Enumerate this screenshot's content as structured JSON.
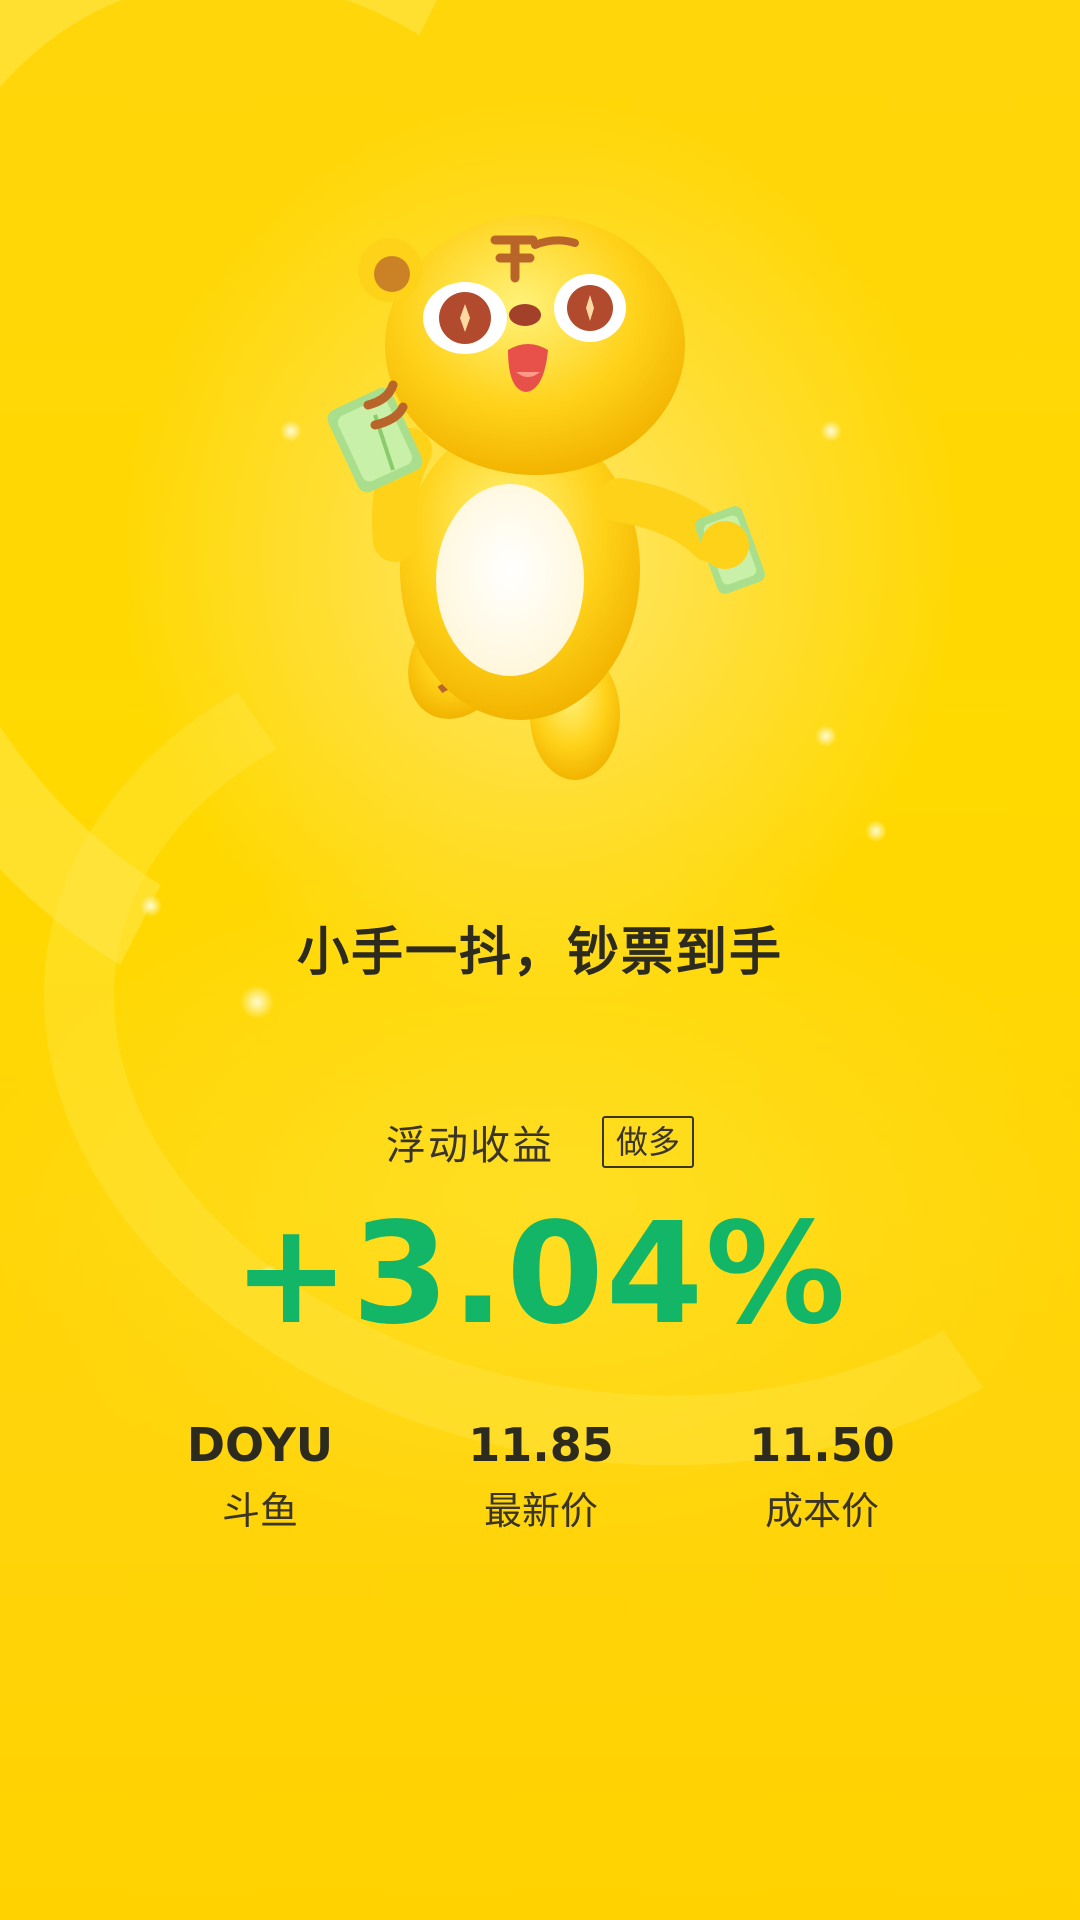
{
  "poster": {
    "slogan": "小手一抖，钞票到手",
    "pnl_label": "浮动收益",
    "direction_badge": "做多",
    "pnl_value": "+3.04%",
    "colors": {
      "background": "#ffd60a",
      "profit": "#13b567",
      "text": "#2d2a1e"
    },
    "mascot_icon": "tiger-mascot-holding-cash",
    "stats": [
      {
        "top": "DOYU",
        "bottom": "斗鱼"
      },
      {
        "top": "11.85",
        "bottom": "最新价"
      },
      {
        "top": "11.50",
        "bottom": "成本价"
      }
    ]
  }
}
